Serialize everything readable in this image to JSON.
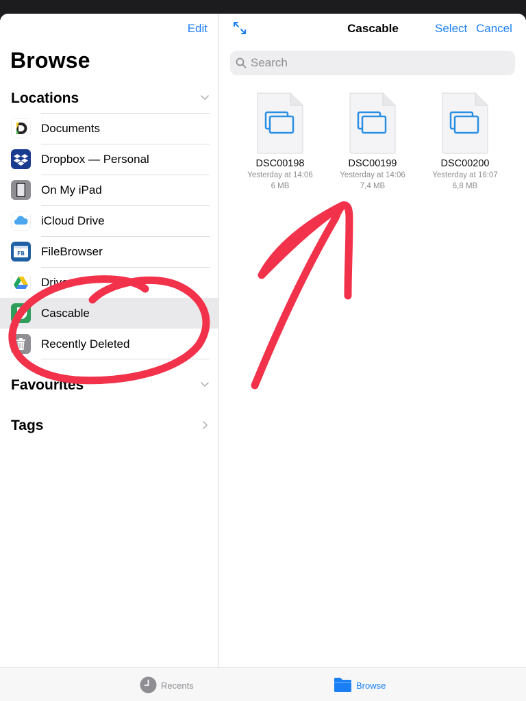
{
  "sidebar": {
    "edit_label": "Edit",
    "title": "Browse",
    "locations_label": "Locations",
    "locations": [
      {
        "label": "Documents"
      },
      {
        "label": "Dropbox — Personal"
      },
      {
        "label": "On My iPad"
      },
      {
        "label": "iCloud Drive"
      },
      {
        "label": "FileBrowser"
      },
      {
        "label": "Drive"
      },
      {
        "label": "Cascable"
      },
      {
        "label": "Recently Deleted"
      }
    ],
    "favourites_label": "Favourites",
    "tags_label": "Tags"
  },
  "main": {
    "title": "Cascable",
    "select_label": "Select",
    "cancel_label": "Cancel",
    "search_placeholder": "Search",
    "files": [
      {
        "name": "DSC00198",
        "date": "Yesterday at 14:06",
        "size": "6 MB"
      },
      {
        "name": "DSC00199",
        "date": "Yesterday at 14:06",
        "size": "7,4 MB"
      },
      {
        "name": "DSC00200",
        "date": "Yesterday at 16:07",
        "size": "6,8 MB"
      }
    ]
  },
  "tabbar": {
    "recents_label": "Recents",
    "browse_label": "Browse"
  },
  "colors": {
    "accent": "#1a7ff5",
    "annotation": "#f2324b",
    "selected_row": "#e9e9eb"
  }
}
